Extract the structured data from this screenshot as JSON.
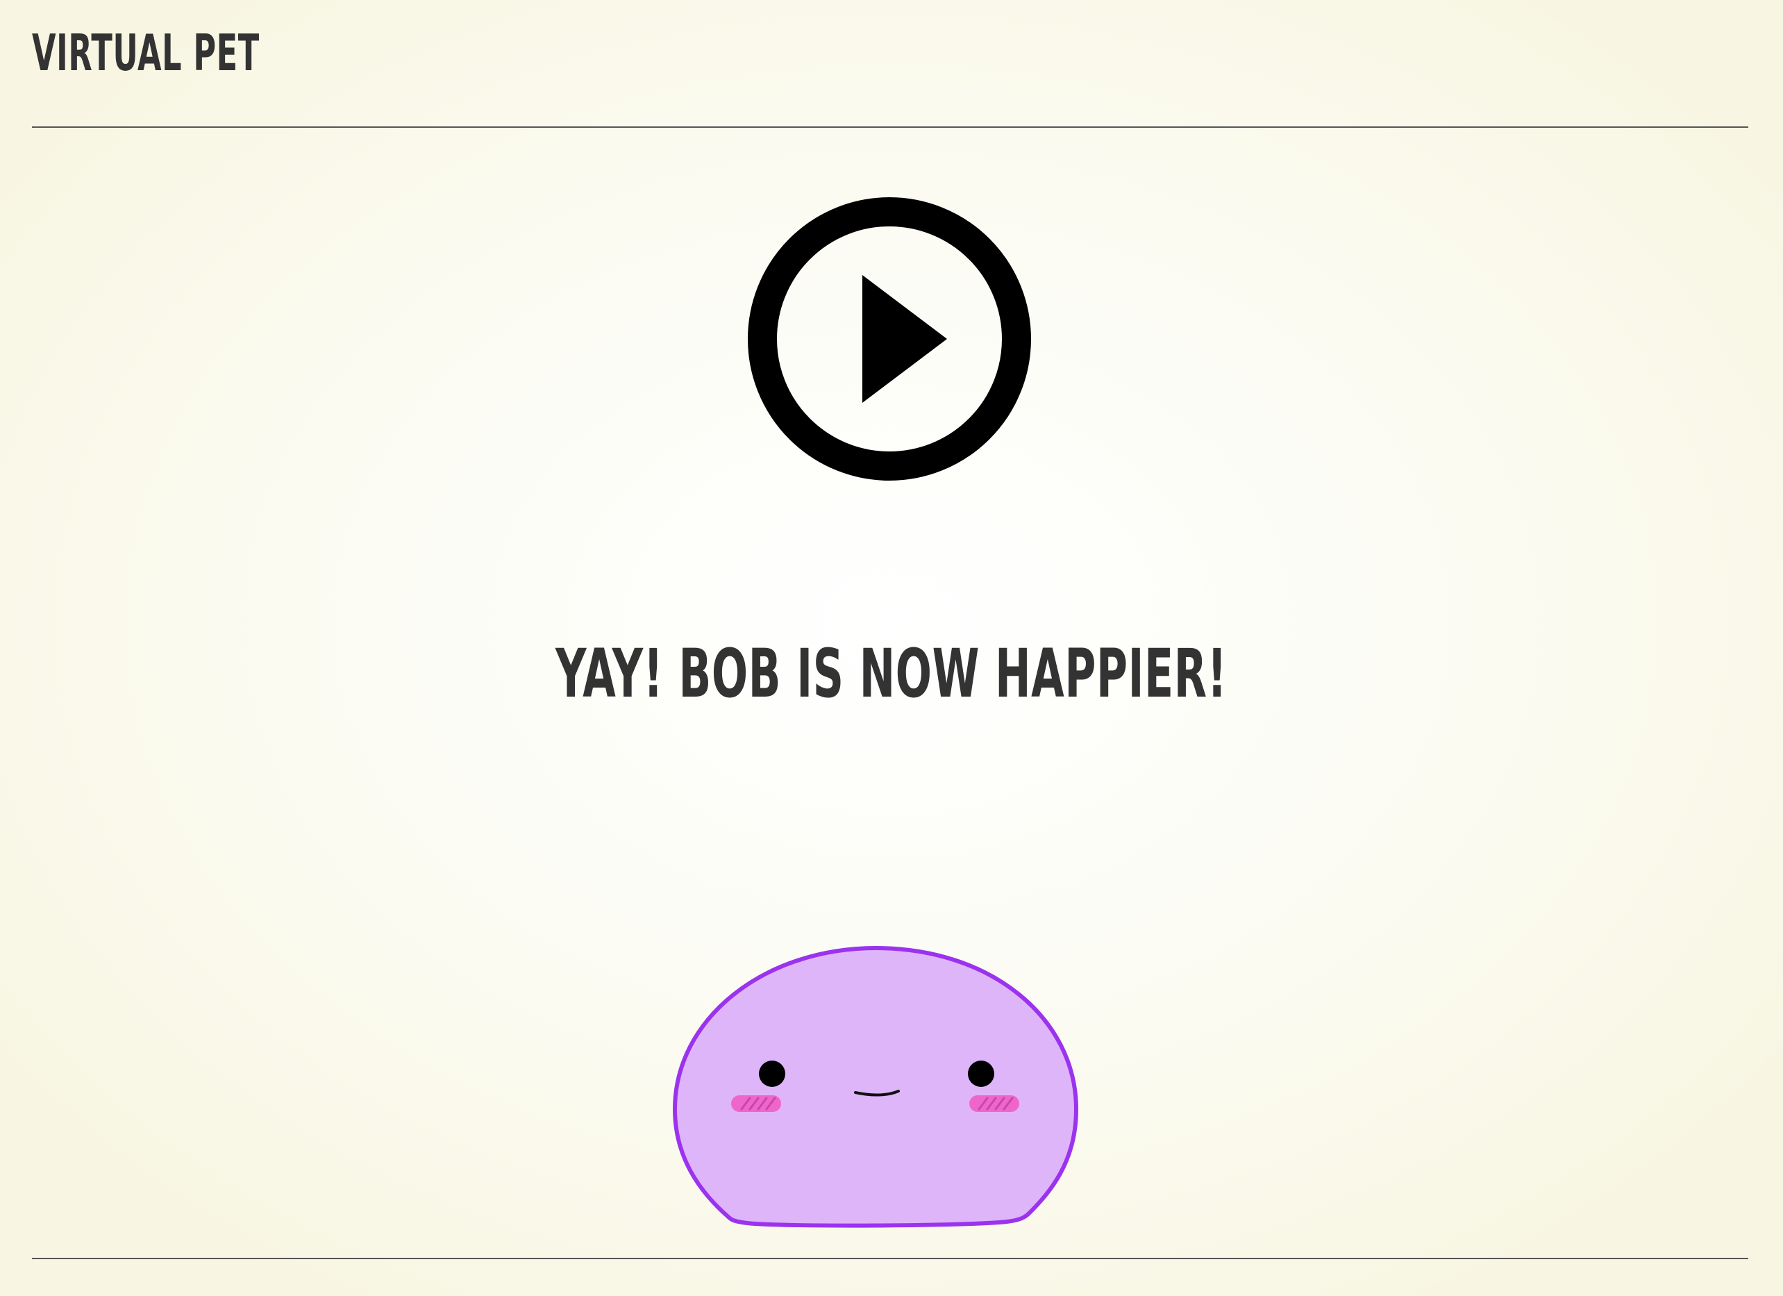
{
  "app": {
    "title": "VIRTUAL PET"
  },
  "play_button": {
    "icon": "play-circle-icon"
  },
  "status": {
    "message": "YAY! BOB IS NOW HAPPIER!"
  },
  "pet": {
    "name": "Bob",
    "icon": "blob-pet",
    "body_color": "#dfb5f9",
    "outline_color": "#9b33ee",
    "blush_color": "#ee66cc"
  },
  "colors": {
    "text": "#333333",
    "background": "#f8f6e2",
    "rule": "#555555"
  }
}
